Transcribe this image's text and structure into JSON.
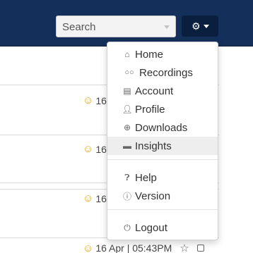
{
  "header": {
    "search_placeholder": "Search",
    "settings_icon": "gear-icon"
  },
  "list": {
    "row_fragment": "16",
    "last_row_date": "16 Apr | 05:43PM"
  },
  "menu": {
    "items": [
      {
        "label": "Home",
        "icon": "home-icon"
      },
      {
        "label": "Recordings",
        "icon": "voicemail-icon"
      },
      {
        "label": "Account",
        "icon": "briefcase-icon"
      },
      {
        "label": "Profile",
        "icon": "user-icon"
      },
      {
        "label": "Downloads",
        "icon": "download-icon"
      },
      {
        "label": "Insights",
        "icon": "comment-icon",
        "highlighted": true
      },
      {
        "label": "Help",
        "icon": "question-icon"
      },
      {
        "label": "Version",
        "icon": "info-icon"
      },
      {
        "label": "Logout",
        "icon": "power-icon"
      }
    ]
  },
  "colors": {
    "navbar": "#14305a",
    "menu_highlight": "#eeeeee",
    "status_smile": "#e5a51d"
  }
}
